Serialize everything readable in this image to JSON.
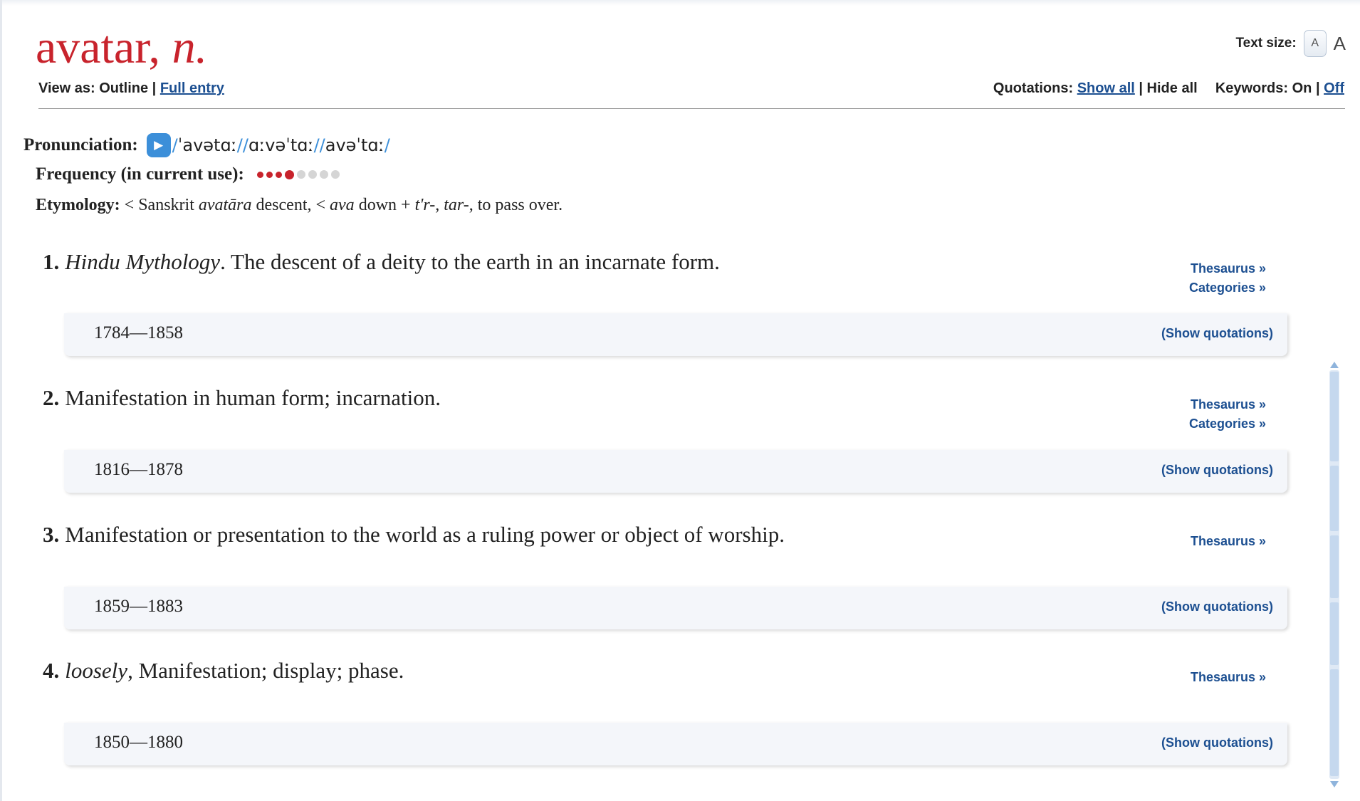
{
  "entry": {
    "headword": "avatar,",
    "pos": "n."
  },
  "view_as": {
    "label": "View as: Outline |",
    "link": "Full entry"
  },
  "text_size": {
    "label": "Text size:",
    "small": "A",
    "large": "A"
  },
  "toolbar": {
    "quotations_label": "Quotations:",
    "show_all": "Show all",
    "hide_all": "| Hide all",
    "keywords_label": "Keywords: On |",
    "keywords_off": "Off"
  },
  "pronunciation": {
    "label": "Pronunciation:",
    "ipa": [
      "ˈavətɑː",
      "ɑːvəˈtɑː",
      "avəˈtɑː"
    ]
  },
  "frequency": {
    "label": "Frequency (in current use):",
    "band": 4,
    "max": 8
  },
  "etymology": {
    "label": "Etymology:",
    "t1": " < Sanskrit ",
    "i1": "avatāra",
    "t2": " descent, < ",
    "i2": "ava",
    "t3": " down + ",
    "i3": "t'r-",
    "t4": ", ",
    "i4": "tar-",
    "t5": ", to pass over."
  },
  "senses": [
    {
      "number": "1.",
      "italic": "Hindu Mythology",
      "text": ". The descent of a deity to the earth in an incarnate form.",
      "thesaurus": "Thesaurus »",
      "categories": "Categories »",
      "range": "1784—1858",
      "show_quotations": "(Show quotations)"
    },
    {
      "number": "2.",
      "italic": "",
      "text": "Manifestation in human form; incarnation.",
      "thesaurus": "Thesaurus »",
      "categories": "Categories »",
      "range": "1816—1878",
      "show_quotations": "(Show quotations)"
    },
    {
      "number": "3.",
      "italic": "",
      "text": "Manifestation or presentation to the world as a ruling power or object of worship.",
      "thesaurus": "Thesaurus »",
      "range": "1859—1883",
      "show_quotations": "(Show quotations)"
    },
    {
      "number": "4.",
      "italic": "loosely",
      "text": ", Manifestation; display; phase.",
      "thesaurus": "Thesaurus »",
      "range": "1850—1880",
      "show_quotations": "(Show quotations)"
    }
  ],
  "colors": {
    "headword": "#c8232c",
    "link": "#1c4f91",
    "play_button": "#3c8fd9",
    "quotation_box": "#f4f6fa"
  },
  "icons": {
    "play": "play-icon"
  }
}
